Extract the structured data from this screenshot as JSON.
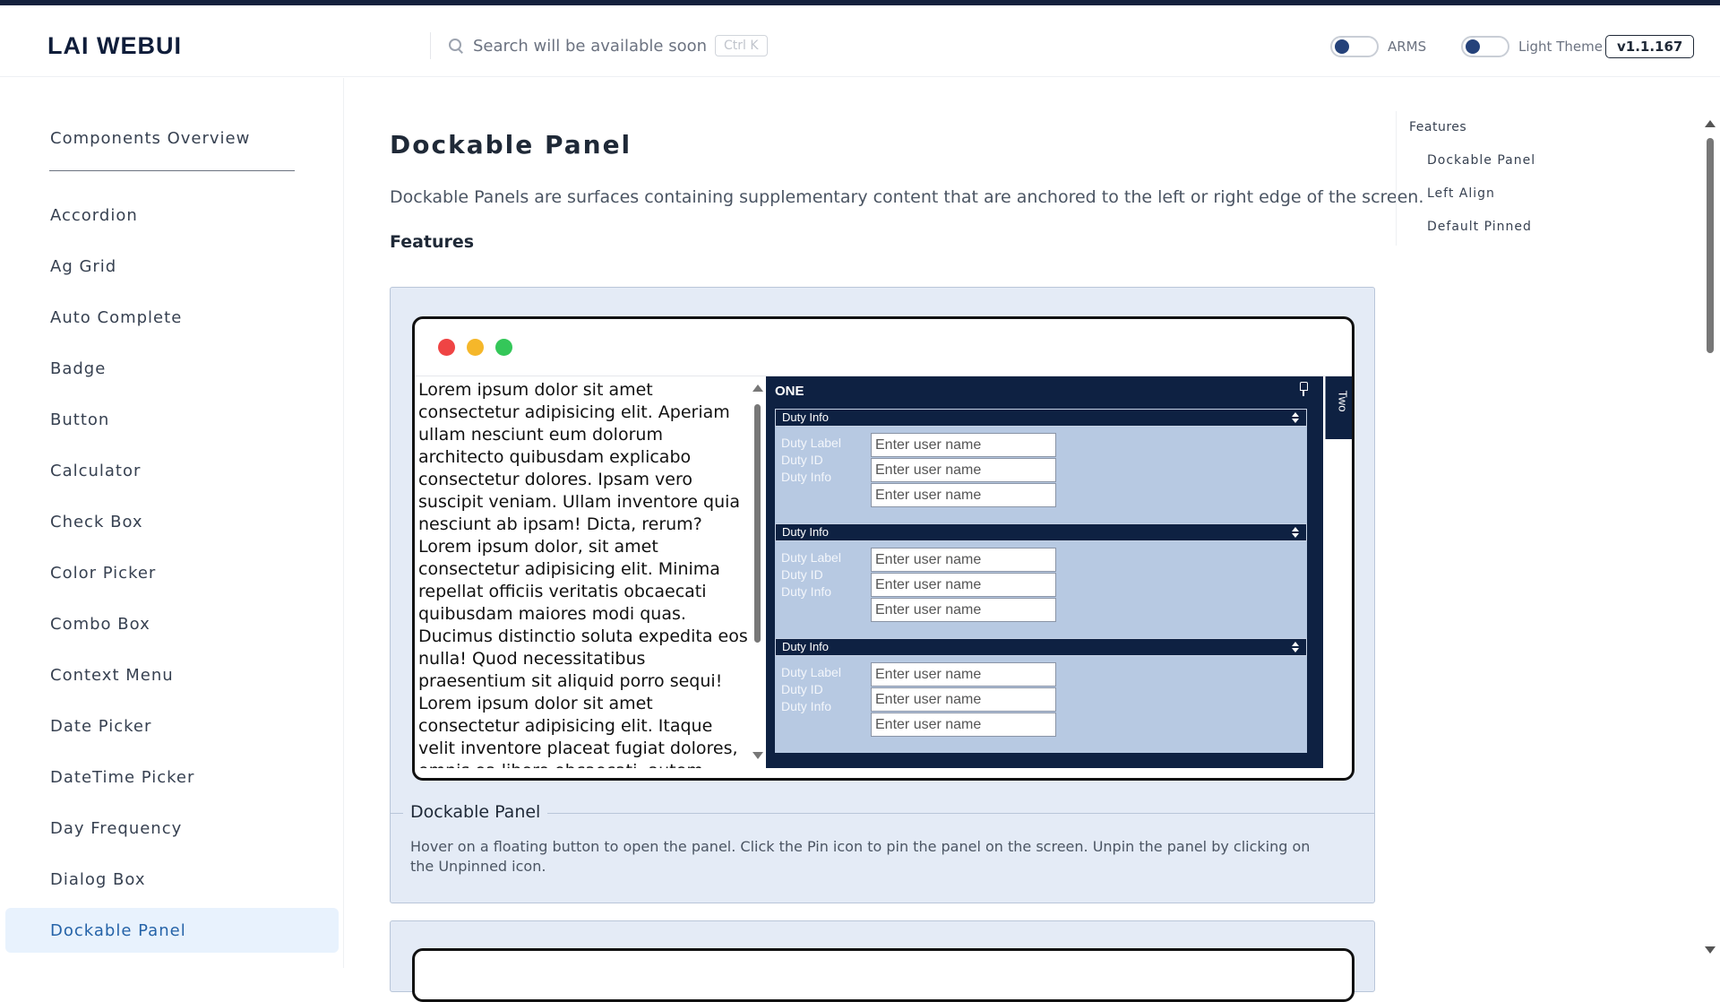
{
  "brand": "LAI WEBUI",
  "search": {
    "placeholder": "Search will be available soon..",
    "shortcut": "Ctrl K"
  },
  "toggles": {
    "arms_label": "ARMS",
    "theme_label": "Light Theme"
  },
  "version": "v1.1.167",
  "sidebar": {
    "overview": "Components Overview",
    "items": [
      {
        "label": "Accordion"
      },
      {
        "label": "Ag Grid"
      },
      {
        "label": "Auto Complete"
      },
      {
        "label": "Badge"
      },
      {
        "label": "Button"
      },
      {
        "label": "Calculator"
      },
      {
        "label": "Check Box"
      },
      {
        "label": "Color Picker"
      },
      {
        "label": "Combo Box"
      },
      {
        "label": "Context Menu"
      },
      {
        "label": "Date Picker"
      },
      {
        "label": "DateTime Picker"
      },
      {
        "label": "Day Frequency"
      },
      {
        "label": "Dialog Box"
      },
      {
        "label": "Dockable Panel"
      }
    ],
    "active": "Dockable Panel"
  },
  "main": {
    "title": "Dockable Panel",
    "description": "Dockable Panels are surfaces containing supplementary content that are anchored to the left or right edge of the screen.",
    "features_heading": "Features"
  },
  "demo": {
    "lorem": "Lorem ipsum dolor sit amet consectetur adipisicing elit. Aperiam ullam nesciunt eum dolorum architecto quibusdam explicabo consectetur dolores. Ipsam vero suscipit veniam. Ullam inventore quia nesciunt ab ipsam! Dicta, rerum? Lorem ipsum dolor, sit amet consectetur adipisicing elit. Minima repellat officiis veritatis obcaecati quibusdam maiores modi quas. Ducimus distinctio soluta expedita eos nulla! Quod necessitatibus praesentium sit aliquid porro sequi! Lorem ipsum dolor sit amet consectetur adipisicing elit. Itaque velit inventore placeat fugiat dolores, omnis ea libero obcaecati, autem eaque quasi, perspiciatis reprehenderit ducimus doloribus! Voluptas, blanditiis explicabo.",
    "panel_title": "ONE",
    "tab_two": "Two",
    "sections": [
      {
        "heading": "Duty Info",
        "labels": [
          "Duty Label",
          "Duty ID",
          "Duty Info"
        ],
        "placeholder": "Enter user name"
      },
      {
        "heading": "Duty Info",
        "labels": [
          "Duty Label",
          "Duty ID",
          "Duty Info"
        ],
        "placeholder": "Enter user name"
      },
      {
        "heading": "Duty Info",
        "labels": [
          "Duty Label",
          "Duty ID",
          "Duty Info"
        ],
        "placeholder": "Enter user name"
      }
    ],
    "legend": "Dockable Panel",
    "legend_desc": "Hover on a floating button to open the panel. Click the Pin icon to pin the panel on the screen. Unpin the panel by clicking on the Unpinned icon."
  },
  "toc": {
    "heading": "Features",
    "items": [
      "Dockable Panel",
      "Left Align",
      "Default Pinned"
    ]
  },
  "colors": {
    "navy": "#0e2142",
    "panel_blue": "#b7c9e2",
    "card_bg": "#e4ebf6",
    "active_bg": "#e8f2fd"
  }
}
